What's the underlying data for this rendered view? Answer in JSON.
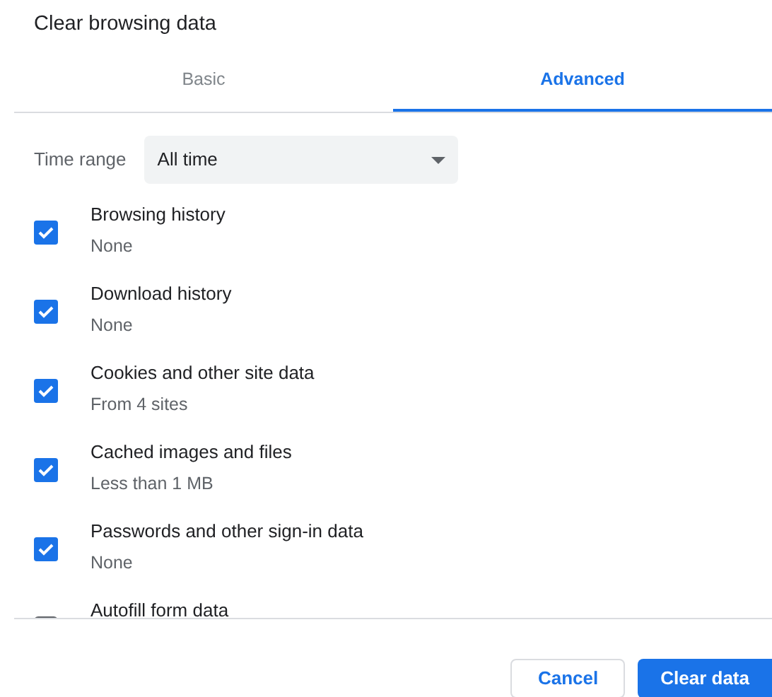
{
  "dialog": {
    "title": "Clear browsing data"
  },
  "tabs": [
    {
      "label": "Basic",
      "selected": false
    },
    {
      "label": "Advanced",
      "selected": true
    }
  ],
  "time_range": {
    "label": "Time range",
    "value": "All time"
  },
  "items": [
    {
      "title": "Browsing history",
      "detail": "None",
      "checked": true
    },
    {
      "title": "Download history",
      "detail": "None",
      "checked": true
    },
    {
      "title": "Cookies and other site data",
      "detail": "From 4 sites",
      "checked": true
    },
    {
      "title": "Cached images and files",
      "detail": "Less than 1 MB",
      "checked": true
    },
    {
      "title": "Passwords and other sign-in data",
      "detail": "None",
      "checked": true
    },
    {
      "title": "Autofill form data",
      "checked": false
    }
  ],
  "buttons": [
    {
      "label": "Cancel",
      "kind": "secondary"
    },
    {
      "label": "Clear data",
      "kind": "primary"
    }
  ]
}
